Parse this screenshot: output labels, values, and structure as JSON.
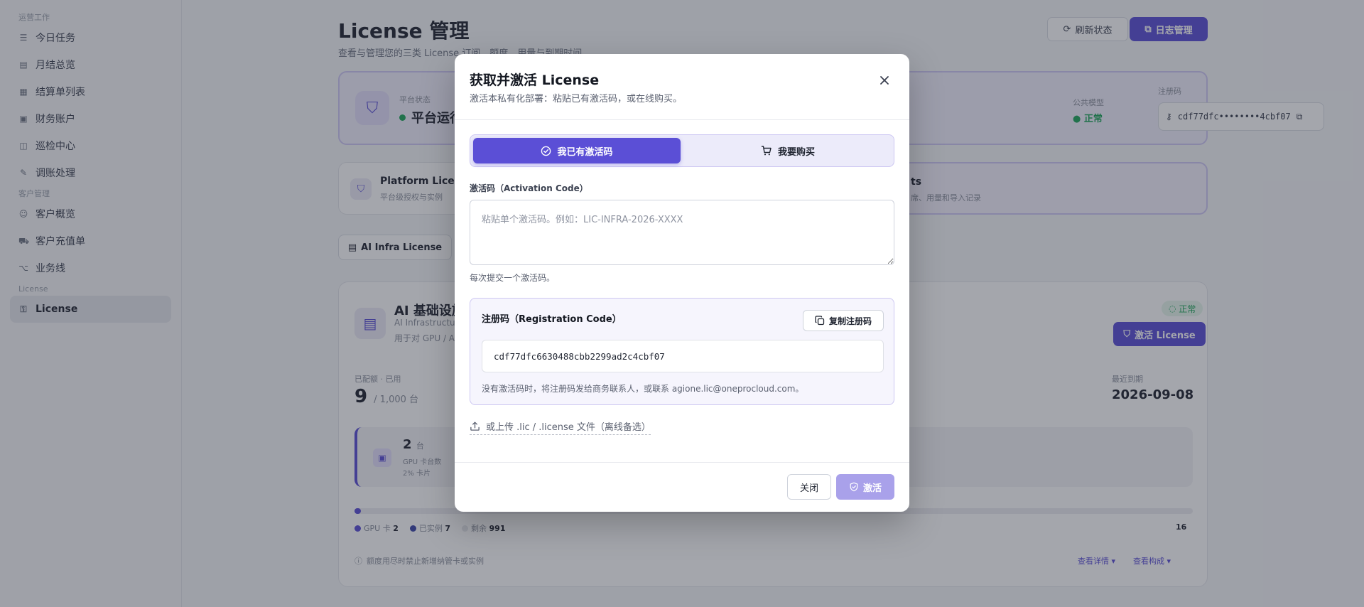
{
  "sidebar": {
    "group1": "运营工作",
    "items": [
      {
        "label": "今日任务",
        "icon": "checklist-icon"
      },
      {
        "label": "月结总览",
        "icon": "chart-icon"
      },
      {
        "label": "结算单列表",
        "icon": "list-icon"
      },
      {
        "label": "财务账户",
        "icon": "wallet-icon"
      },
      {
        "label": "巡检中心",
        "icon": "inspect-icon"
      },
      {
        "label": "调账处理",
        "icon": "wrench-icon"
      }
    ],
    "group2": "客户管理",
    "items2": [
      {
        "label": "客户概览",
        "icon": "user-icon"
      },
      {
        "label": "客户充值单",
        "icon": "cart-icon"
      },
      {
        "label": "业务线",
        "icon": "branch-icon"
      }
    ],
    "group3": "License",
    "active_item": "License"
  },
  "page": {
    "title": "License 管理",
    "subtitle": "查看与管理您的三类 License 订阅、额度、用量与到期时间",
    "refresh_btn": "刷新状态",
    "log_btn": "日志管理"
  },
  "status_card": {
    "label": "平台状态",
    "status": "平台运行",
    "public_label": "公共模型",
    "public_value": "● 正常",
    "reg_label": "注册码",
    "reg_masked": "cdf77dfc••••••••4cbf07"
  },
  "platform_card": {
    "title": "Platform Lice",
    "sub": "平台级授权与实例"
  },
  "seats_card": {
    "title": "ts",
    "sub": "席、用量和导入记录"
  },
  "tab": {
    "label": "AI Infra License"
  },
  "infra_card": {
    "title": "AI 基础设施",
    "sub1": "AI Infrastructu",
    "sub2": "用于对 GPU / A",
    "badge": "正常",
    "activate_btn": "激活 License",
    "used_label": "已配额 · 已用",
    "used_value": "9",
    "used_total": "/ 1,000 台",
    "expire_label": "最近到期",
    "expire_value": "2026-09-08",
    "box_num": "2",
    "box_unit": "台",
    "box_l1": "GPU 卡台数",
    "box_l2": "2% 卡片",
    "progress_fraction": 0.007,
    "legend": [
      {
        "label": "GPU 卡",
        "value": "2",
        "color": "#5b4fd6"
      },
      {
        "label": "已实例",
        "value": "7",
        "color": "#3b46a8"
      },
      {
        "label": "剩余",
        "value": "991",
        "color": "#e5e7eb"
      }
    ],
    "legend_total": "16",
    "note": "额度用尽时禁止新增纳管卡或实例",
    "link1": "查看详情 ▾",
    "link2": "查看构成 ▾"
  },
  "modal": {
    "title": "获取并激活 License",
    "desc": "激活本私有化部署：粘贴已有激活码，或在线购买。",
    "seg_have": "我已有激活码",
    "seg_buy": "我要购买",
    "field_label": "激活码（Activation Code）",
    "field_placeholder": "粘贴单个激活码。例如：LIC-INFRA-2026-XXXX",
    "field_help": "每次提交一个激活码。",
    "reg_title": "注册码（Registration Code）",
    "reg_copy": "复制注册码",
    "reg_code": "cdf77dfc6630488cbb2299ad2c4cbf07",
    "reg_note": "没有激活码时，将注册码发给商务联系人，或联系 agione.lic@oneprocloud.com。",
    "upload_link": "或上传 .lic / .license 文件（离线备选）",
    "close_btn": "关闭",
    "activate_btn": "激活"
  }
}
